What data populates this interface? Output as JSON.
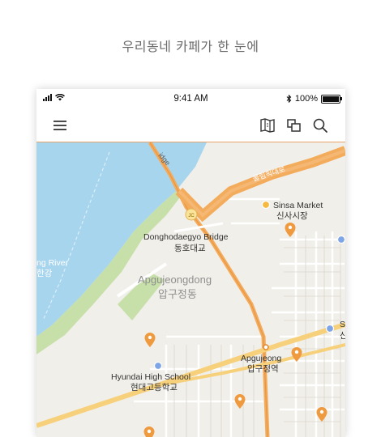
{
  "caption": "우리동네 카페가 한 눈에",
  "status_bar": {
    "time": "9:41 AM",
    "battery": "100%"
  },
  "nav": {
    "menu_icon": "hamburger-icon",
    "map_icon": "map-icon",
    "layers_icon": "layers-icon",
    "search_icon": "search-icon"
  },
  "map": {
    "road_label": "올림픽대로",
    "bridge_fragment": "idge",
    "jc_label": "JC",
    "places": {
      "sinsa_market_en": "Sinsa Market",
      "sinsa_market_ko": "신사시장",
      "donghodaegyo_en": "Donghodaegyo Bridge",
      "donghodaegyo_ko": "동호대교",
      "han_river_en": "ng River",
      "han_river_ko": "한강",
      "apgujeongdong_en": "Apgujeongdong",
      "apgujeongdong_ko": "압구정동",
      "apgujeong_station_en": "Apgujeong",
      "apgujeong_station_ko": "압구정역",
      "hyundai_hs_en": "Hyundai High School",
      "hyundai_hs_ko": "현대고등학교",
      "edge_s": "S",
      "edge_sin": "신"
    },
    "colors": {
      "water": "#a8d5ee",
      "land": "#f1efe9",
      "park": "#c7dfa9",
      "highway": "#f3ab5c",
      "marker": "#ef9a3e",
      "poi_blue": "#7ea6e6"
    }
  }
}
